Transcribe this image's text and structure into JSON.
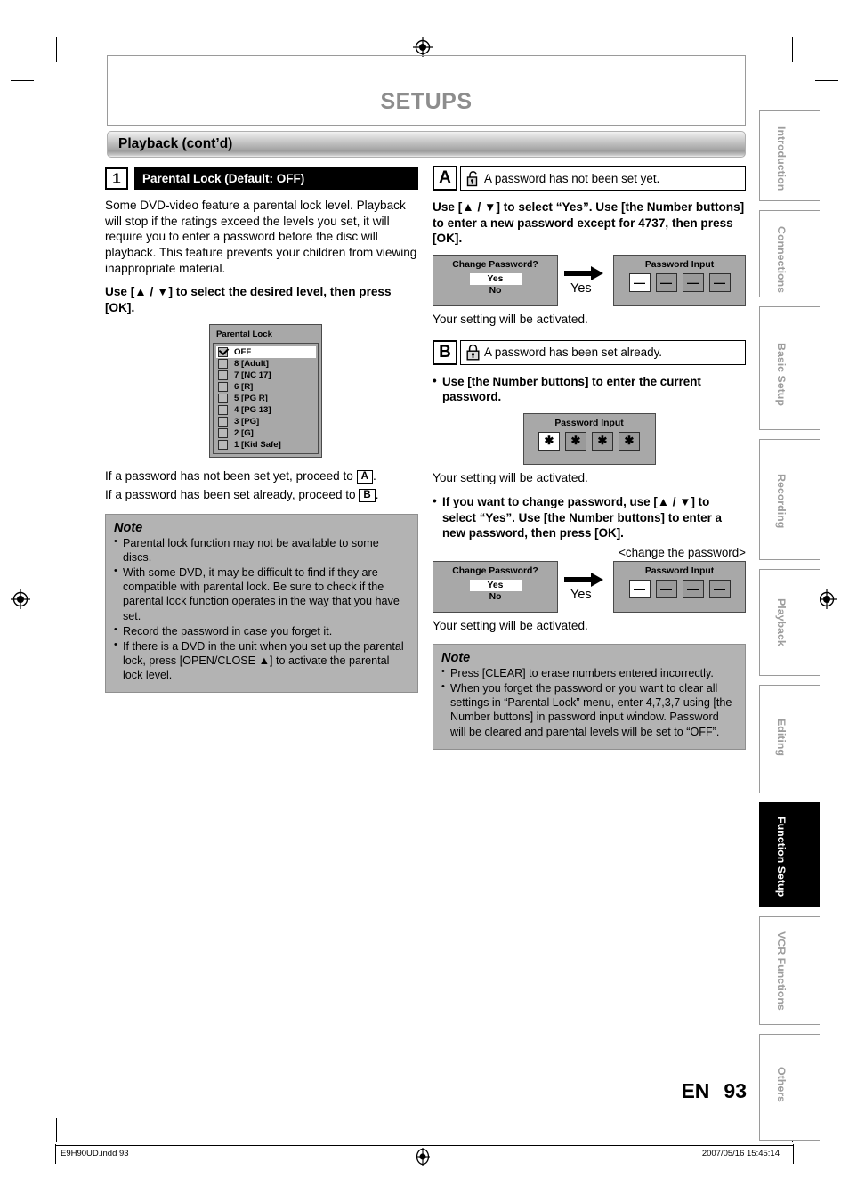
{
  "chapter_title": "SETUPS",
  "section_bar": {
    "label": "Playback (cont’d)"
  },
  "left_column": {
    "step": {
      "number": "1",
      "title": "Parental Lock (Default: OFF)"
    },
    "intro": "Some DVD-video feature a parental lock level. Playback will stop if the ratings exceed the levels you set, it will require you to enter a password before the disc will playback. This feature prevents your children from viewing inappropriate material.",
    "instruction": "Use [▲ / ▼] to select the desired level, then press [OK].",
    "parental_menu": {
      "title": "Parental Lock",
      "items": [
        {
          "label": "OFF",
          "checked": true,
          "selected": true
        },
        {
          "label": "8 [Adult]",
          "checked": false,
          "selected": false
        },
        {
          "label": "7 [NC 17]",
          "checked": false,
          "selected": false
        },
        {
          "label": "6 [R]",
          "checked": false,
          "selected": false
        },
        {
          "label": "5 [PG R]",
          "checked": false,
          "selected": false
        },
        {
          "label": "4 [PG 13]",
          "checked": false,
          "selected": false
        },
        {
          "label": "3 [PG]",
          "checked": false,
          "selected": false
        },
        {
          "label": "2 [G]",
          "checked": false,
          "selected": false
        },
        {
          "label": "1 [Kid Safe]",
          "checked": false,
          "selected": false
        }
      ]
    },
    "proceed_a_before": "If a password has not been set yet, proceed to ",
    "proceed_a_ref": "A",
    "proceed_a_after": ".",
    "proceed_b_before": "If a password has been set already, proceed to ",
    "proceed_b_ref": "B",
    "proceed_b_after": ".",
    "note": {
      "title": "Note",
      "items": [
        "Parental lock function may not be available to some discs.",
        "With some DVD, it may be difficult to find if they are compatible with parental lock. Be sure to check if the parental lock function operates in the way that you have set.",
        "Record the password in case you forget it.",
        "If there is a DVD in the unit when you set up the parental lock, press [OPEN/CLOSE ▲] to activate the parental lock level."
      ]
    }
  },
  "right_column": {
    "section_a": {
      "letter": "A",
      "icon": "unlocked-padlock-icon",
      "heading": "A password has not been set yet.",
      "instruction": "Use [▲ / ▼] to select “Yes”. Use [the Number buttons] to enter a new password except for 4737, then press [OK].",
      "change_password_screen": {
        "title": "Change Password?",
        "yes": "Yes",
        "no": "No",
        "selected": "Yes"
      },
      "arrow_label": "Yes",
      "password_input_screen": {
        "title": "Password Input",
        "cells": [
          "—",
          "—",
          "—",
          "—"
        ],
        "highlight_index": 0
      },
      "activated_text": "Your setting will be activated."
    },
    "section_b": {
      "letter": "B",
      "icon": "locked-padlock-icon",
      "heading": "A password has been set already.",
      "bullet_1": "Use [the Number buttons] to enter the current password.",
      "password_input_screen": {
        "title": "Password Input",
        "cells": [
          "✱",
          "✱",
          "✱",
          "✱"
        ],
        "highlight_index": 0
      },
      "activated_text_1": "Your setting will be activated.",
      "bullet_2": "If you want to change password, use [▲ / ▼] to select “Yes”. Use [the Number buttons] to enter a new password, then press [OK].",
      "change_caption": "<change the password>",
      "change_password_screen": {
        "title": "Change Password?",
        "yes": "Yes",
        "no": "No",
        "selected": "Yes"
      },
      "arrow_label": "Yes",
      "password_input_screen_2": {
        "title": "Password Input",
        "cells": [
          "—",
          "—",
          "—",
          "—"
        ],
        "highlight_index": 0
      },
      "activated_text_2": "Your setting will be activated."
    },
    "note": {
      "title": "Note",
      "items": [
        "Press [CLEAR] to erase numbers entered incorrectly.",
        "When you forget the password or you want to clear all settings in “Parental Lock” menu, enter 4,7,3,7 using [the Number buttons] in password input window. Password will be cleared and parental levels will be set to “OFF”."
      ]
    }
  },
  "index_tabs": [
    {
      "label": "Introduction",
      "active": false
    },
    {
      "label": "Connections",
      "active": false
    },
    {
      "label": "Basic Setup",
      "active": false
    },
    {
      "label": "Recording",
      "active": false
    },
    {
      "label": "Playback",
      "active": false
    },
    {
      "label": "Editing",
      "active": false
    },
    {
      "label": "Function Setup",
      "active": true
    },
    {
      "label": "VCR Functions",
      "active": false
    },
    {
      "label": "Others",
      "active": false
    }
  ],
  "footer": {
    "language": "EN",
    "page_number": "93",
    "file_name": "E9H90UD.indd   93",
    "timestamp": "2007/05/16   15:45:14"
  }
}
